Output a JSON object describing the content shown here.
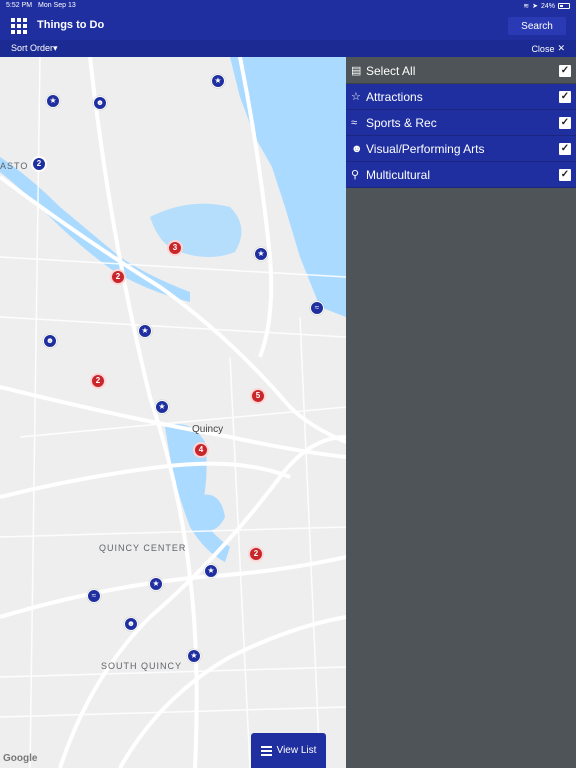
{
  "status": {
    "time": "5:52 PM",
    "date": "Mon Sep 13",
    "battery": "24%"
  },
  "header": {
    "title": "Things to Do",
    "search_label": "Search"
  },
  "subbar": {
    "sort_label": "Sort Order▾",
    "close_label": "Close"
  },
  "map": {
    "labels": [
      "Quincy",
      "QUINCY CENTER",
      "SOUTH QUINCY",
      "ASTO"
    ],
    "attribution": "Google",
    "clusters": [
      "2",
      "3",
      "2",
      "2",
      "5",
      "4",
      "2"
    ]
  },
  "view_list_label": "View List",
  "panel": {
    "select_all": "Select All",
    "categories": [
      {
        "label": "Attractions",
        "icon": "star-outline-icon",
        "checked": true
      },
      {
        "label": "Sports & Rec",
        "icon": "sneaker-icon",
        "checked": true
      },
      {
        "label": "Visual/Performing Arts",
        "icon": "theater-masks-icon",
        "checked": true
      },
      {
        "label": "Multicultural",
        "icon": "map-pin-icon",
        "checked": true
      }
    ]
  },
  "colors": {
    "brand_blue": "#1f2fa0",
    "cluster_red": "#c7262a",
    "panel_gray": "#4e5457"
  }
}
